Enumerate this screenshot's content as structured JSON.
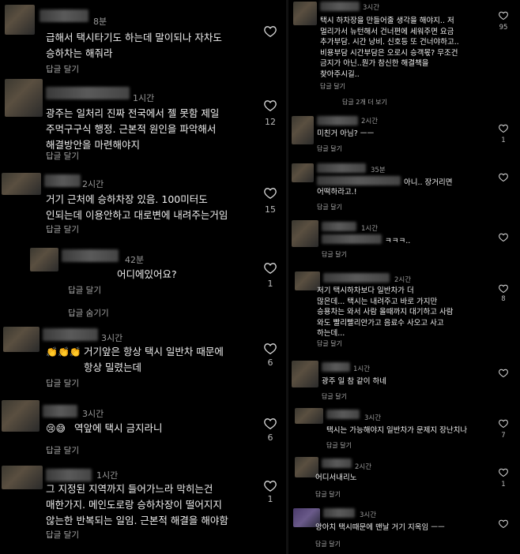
{
  "left": [
    {
      "time": "8분",
      "text": "급해서 택시타기도 하는데 말이되나 자차도\n승하차는 해줘라",
      "reply": "답글 달기",
      "likes": ""
    },
    {
      "time": "1시간",
      "text": "광주는 일처리 진짜 전국에서 젤 못함 제일\n주먹구구식 행정. 근본적 원인을 파악해서\n해결방안을 마련해야지",
      "reply": "답글 달기",
      "likes": "12"
    },
    {
      "time": "2시간",
      "text": "거기 근처에 승하차장 있음. 100미터도\n인되는데 이용안하고 대로변에 내려주는거임",
      "reply": "답글 달기",
      "likes": "15"
    },
    {
      "time": "42분",
      "text": "어디에있어요?",
      "reply": "답글 달기",
      "hide": "답글 숨기기",
      "likes": "1"
    },
    {
      "time": "3시간",
      "text": "거기앞은 항상 택시 일반차 때문에\n항상 밀렸는데",
      "emoji": "👏👏👏",
      "reply": "답글 달기",
      "likes": "6"
    },
    {
      "time": "3시간",
      "text": "역앞에 택시 금지라니",
      "emoji": "😢😅",
      "reply": "답글 달기",
      "likes": "6"
    },
    {
      "time": "1시간",
      "text": "그 지정된 지역까지 들어가느라 막히는건\n매한가지. 메인도로랑 승하차장이 떨어지지\n않는한 반복되는 일임. 근본적 해결을 해야함",
      "reply": "답글 달기",
      "likes": "1"
    }
  ],
  "right": [
    {
      "time": "3시간",
      "text": "택시 하차장을 만들어줄 생각을 해야지.. 저\n멀리가서 뉴턴해서 건너편에 세워주면 요금\n추가부담. 시간 낭비. 신호등 또 건너야하고..\n비용부담 시간부담은 오로시 승객몫? 무조건\n금지가 아닌..뭔가 참신한 해결책을\n찾아주시길..",
      "reply": "답글 달기",
      "more": "답글 2개 더 보기",
      "likes": "95"
    },
    {
      "time": "2시간",
      "text": "미친거 아님? ㅡㅡ",
      "reply": "답글 달기",
      "likes": "1"
    },
    {
      "time": "35분",
      "text": "어떡하라고.!",
      "text2": "아니.. 장거리면",
      "reply": "답글 달기",
      "likes": ""
    },
    {
      "time": "1시간",
      "text": "ㅋㅋㅋ..",
      "reply": "답글 달기",
      "likes": ""
    },
    {
      "time": "2시간",
      "text": "저기 택시하차보다 일반차가 더\n많은데... 택시는 내려주고 바로 가지만\n승용차는 와서 사람 올때까지 대기하고 사람\n와도 빨리빨리안가고 음료수 사오고 사고\n하는데...",
      "reply": "답글 달기",
      "likes": "8"
    },
    {
      "time": "1시간",
      "text": "광주 일 참    같이 하네",
      "reply": "답글 달기",
      "likes": ""
    },
    {
      "time": "3시간",
      "text": "택시는 가능해야지 일반차가 문제지 장난치나",
      "reply": "답글 달기",
      "likes": "7"
    },
    {
      "time": "2시간",
      "text": "어디서내리노",
      "reply": "답글 달기",
      "likes": "1"
    },
    {
      "time": "3시간",
      "text": "앙아치 택시때문에 맨날 거기 지옥임 ㅡㅡ",
      "reply": "답글 달기",
      "likes": ""
    }
  ],
  "icons": {
    "like": "heart-outline-icon"
  }
}
